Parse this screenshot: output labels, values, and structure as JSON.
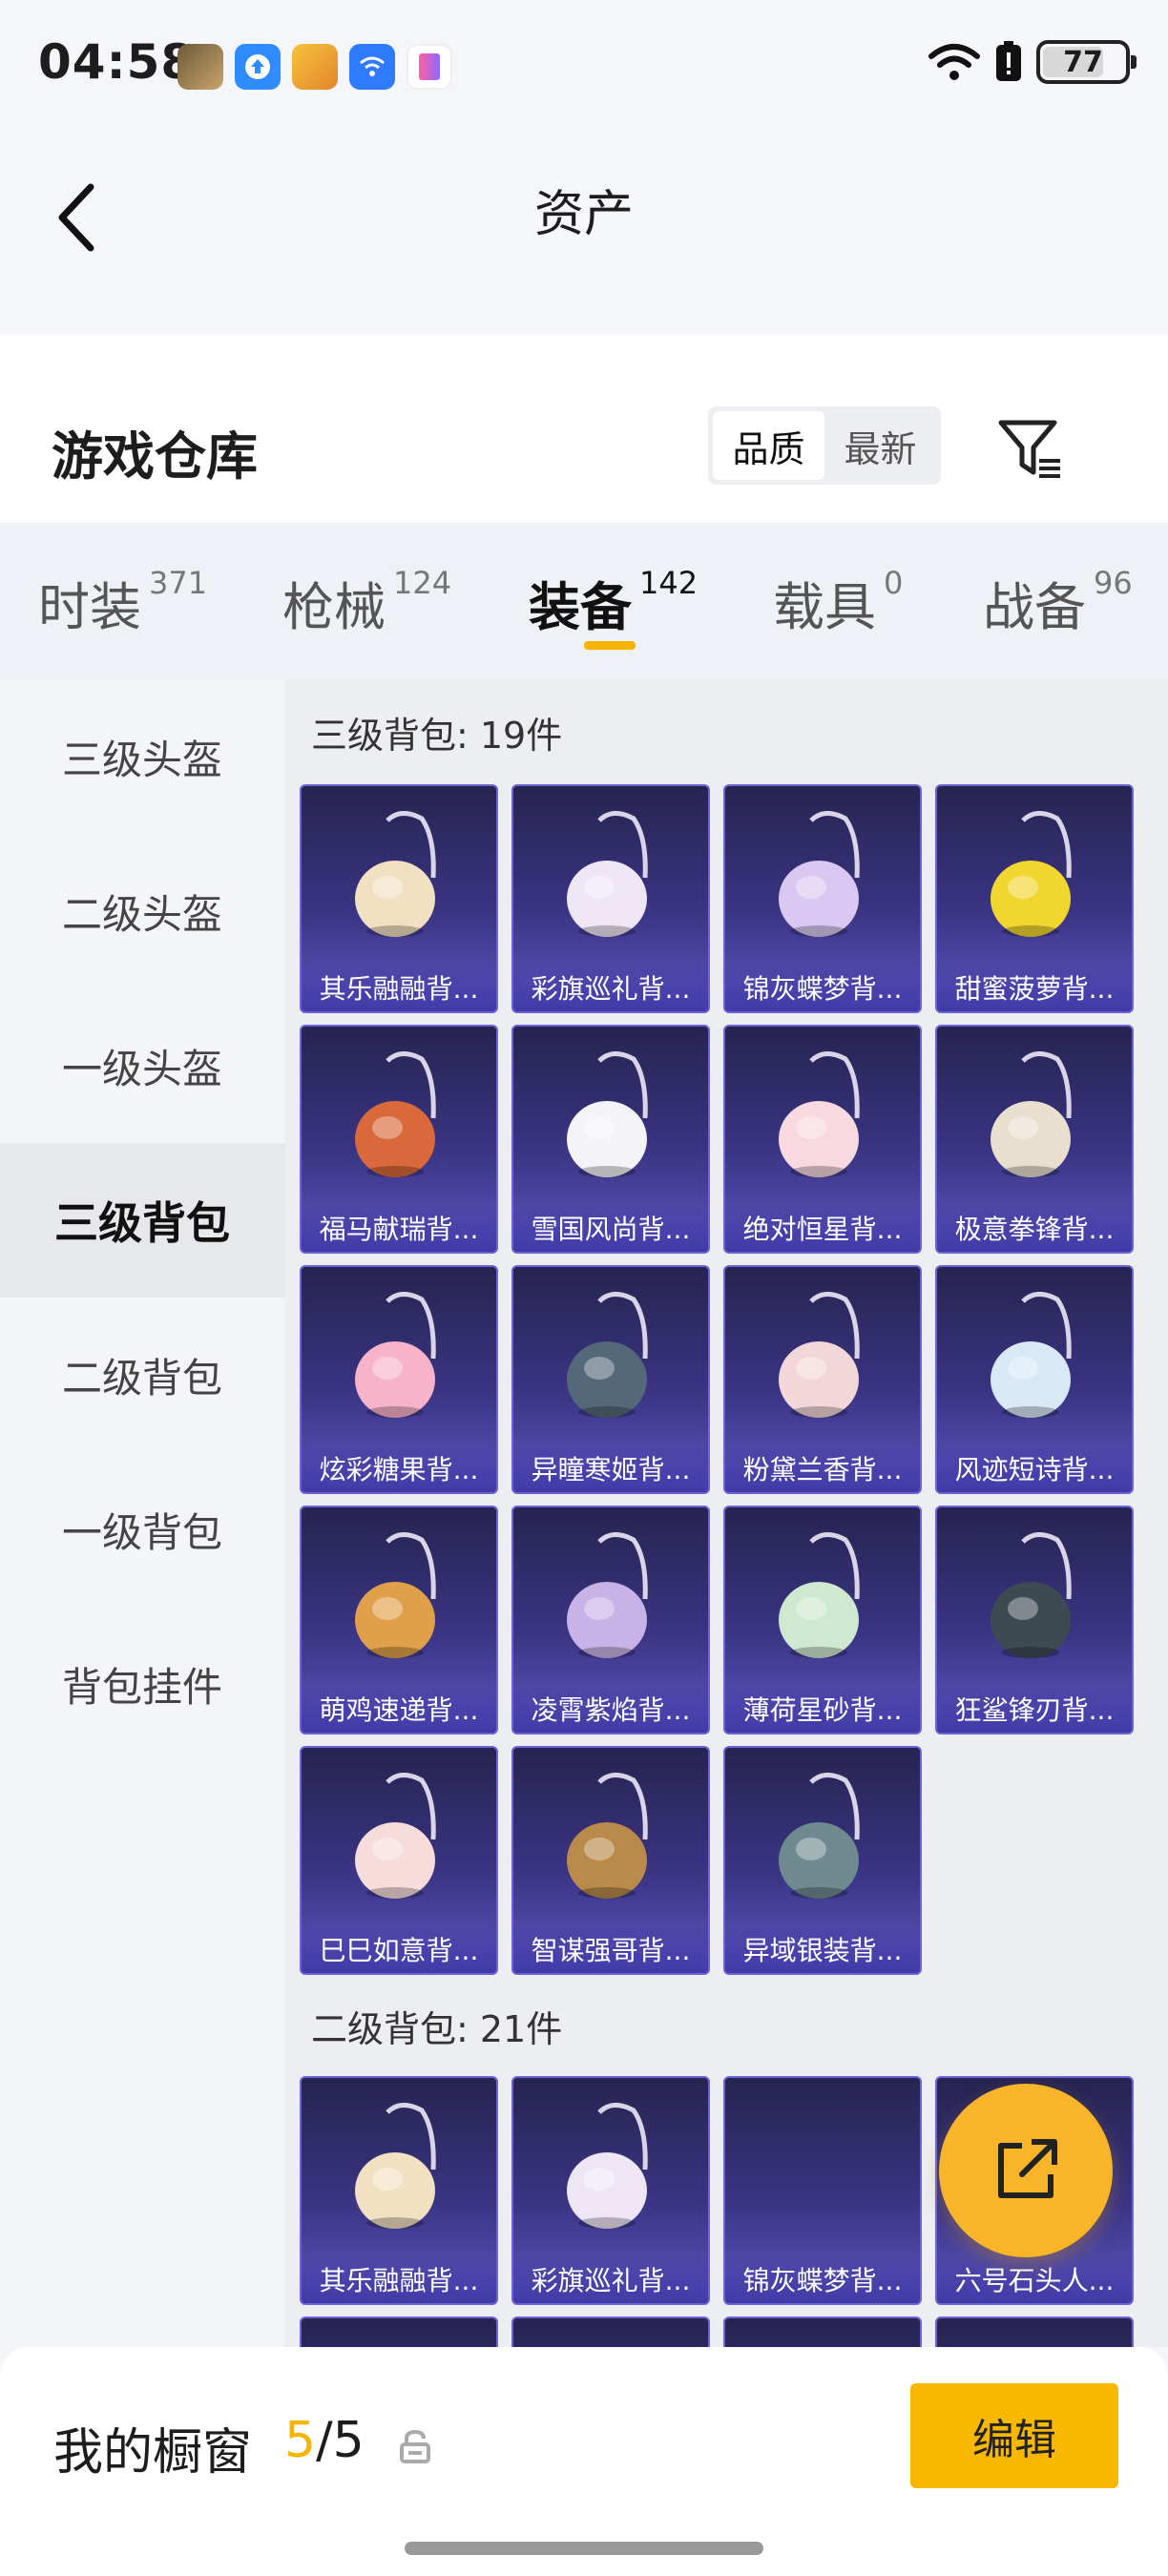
{
  "status_bar": {
    "time": "04:58",
    "battery": "77",
    "battery_level": 0.77,
    "icons": [
      "pubg-app-icon",
      "upload-app-icon",
      "peace-elite-app-icon",
      "wifi-app-icon",
      "book-app-icon",
      "wifi-signal-icon",
      "battery-alert-icon"
    ]
  },
  "header": {
    "title": "资产",
    "back_icon": "chevron-left-icon"
  },
  "warehouse": {
    "title": "游戏仓库",
    "sort_options": [
      "品质",
      "最新"
    ],
    "sort_selected": "品质",
    "filter_icon": "filter-icon"
  },
  "tabs": [
    {
      "label": "时装",
      "count": "371"
    },
    {
      "label": "枪械",
      "count": "124"
    },
    {
      "label": "装备",
      "count": "142",
      "active": true
    },
    {
      "label": "载具",
      "count": "0"
    },
    {
      "label": "战备",
      "count": "96"
    }
  ],
  "sidebar": {
    "items": [
      "三级头盔",
      "二级头盔",
      "一级头盔",
      "三级背包",
      "二级背包",
      "一级背包",
      "背包挂件"
    ],
    "active": "三级背包"
  },
  "sections": [
    {
      "title": "三级背包: 19件",
      "items": [
        "其乐融融背...",
        "彩旗巡礼背...",
        "锦灰蝶梦背...",
        "甜蜜菠萝背...",
        "福马献瑞背...",
        "雪国风尚背...",
        "绝对恒星背...",
        "极意拳锋背...",
        "炫彩糖果背...",
        "异瞳寒姬背...",
        "粉黛兰香背...",
        "风迹短诗背...",
        "萌鸡速递背...",
        "凌霄紫焰背...",
        "薄荷星砂背...",
        "狂鲨锋刃背...",
        "巳巳如意背...",
        "智谋强哥背...",
        "异域银装背..."
      ]
    },
    {
      "title": "二级背包: 21件",
      "items": [
        "其乐融融背...",
        "彩旗巡礼背...",
        "锦灰蝶梦背...",
        "六号石头人..."
      ]
    }
  ],
  "fab": {
    "icon": "share-external-icon"
  },
  "bottom_bar": {
    "showcase_label": "我的橱窗",
    "showcase_current": "5",
    "showcase_total": "/5",
    "lock_icon": "lock-icon",
    "edit_label": "编辑"
  }
}
